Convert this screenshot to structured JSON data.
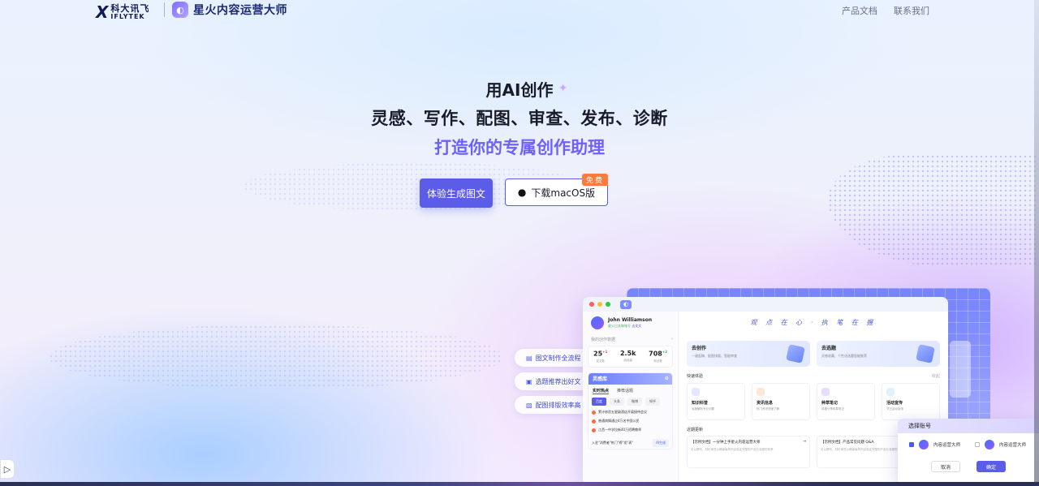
{
  "header": {
    "brand": {
      "mark": "X",
      "cn": "科大讯飞",
      "en": "IFLYTEK"
    },
    "product": {
      "name": "星火内容运营大师"
    },
    "nav": [
      {
        "label": "产品文档"
      },
      {
        "label": "联系我们"
      }
    ]
  },
  "hero": {
    "line1": "用AI创作",
    "line2": "灵感、写作、配图、审查、发布、诊断",
    "line3": "打造你的专属创作助理",
    "primary_button": "体验生成图文",
    "download_button": "下载macOS版",
    "download_badge": "免费"
  },
  "features": [
    {
      "label": "图文制作全流程",
      "icon": "document-icon"
    },
    {
      "label": "选题推荐出好文",
      "icon": "image-icon"
    },
    {
      "label": "配图排版效率高",
      "icon": "picture-icon"
    }
  ],
  "mock": {
    "user": {
      "name": "John Williamson",
      "tag": "星火已关联账号",
      "tag_link": "去发文"
    },
    "stats_title": "我的创作数据",
    "stats": [
      {
        "num": "25",
        "delta": "+1",
        "label": "发文数"
      },
      {
        "num": "2.5k",
        "delta": "",
        "label": "阅读量"
      },
      {
        "num": "708",
        "delta": "+2",
        "label": "粉丝数"
      }
    ],
    "lingan": {
      "title": "灵感库",
      "tabs": [
        "实时热点",
        "推荐话题"
      ],
      "chips": [
        "百度",
        "头条",
        "微博",
        "知乎"
      ],
      "items": [
        "累计核验五星级酒店开展接待会议",
        "普通病情通过4万名中国公民",
        "江西一中学拉新40万招聘教师"
      ],
      "footer_text": "入驻\"消费者\"热门\"榜\"发\"表\"",
      "ai_button": "AI生成"
    },
    "banner": "观 点 在 心 · 执 笔 在 握",
    "cards": [
      {
        "title": "去创作",
        "desc": "一键起稿、配图排版、智能审查"
      },
      {
        "title": "去选题",
        "desc": "灵感收藏、个性化选题智能推荐"
      }
    ],
    "quick_title": "快速体验",
    "quick_more": "收起",
    "quick": [
      {
        "title": "知识科普",
        "desc": "深度解析专业问题"
      },
      {
        "title": "资讯信息",
        "desc": "热门资讯快速了解"
      },
      {
        "title": "种草笔记",
        "desc": "风格分享种草笔记"
      },
      {
        "title": "活动宣传",
        "desc": "节日活动宣传"
      }
    ],
    "recent_title": "近期更新",
    "recent": [
      {
        "title": "【示例文档】一分钟上手星火内容运营大师",
        "desc": "可以撰写、材料审查以确保每章内容真实完整的产品与流程的效率"
      },
      {
        "title": "【示例文档】产品常见问题 Q&A",
        "desc": "可以撰写、材料审查以确保每章内容真实完整的产品与流程的效率"
      }
    ]
  },
  "dialog": {
    "title": "选择账号",
    "accounts": [
      {
        "label": "内容运营大师",
        "checked": true
      },
      {
        "label": "内容运营大师",
        "checked": false
      }
    ],
    "cancel": "取消",
    "confirm": "确定"
  },
  "colors": {
    "accent": "#5b5ce8",
    "badge": "#ff7a3c",
    "gradient_end": "#8a5cff"
  }
}
